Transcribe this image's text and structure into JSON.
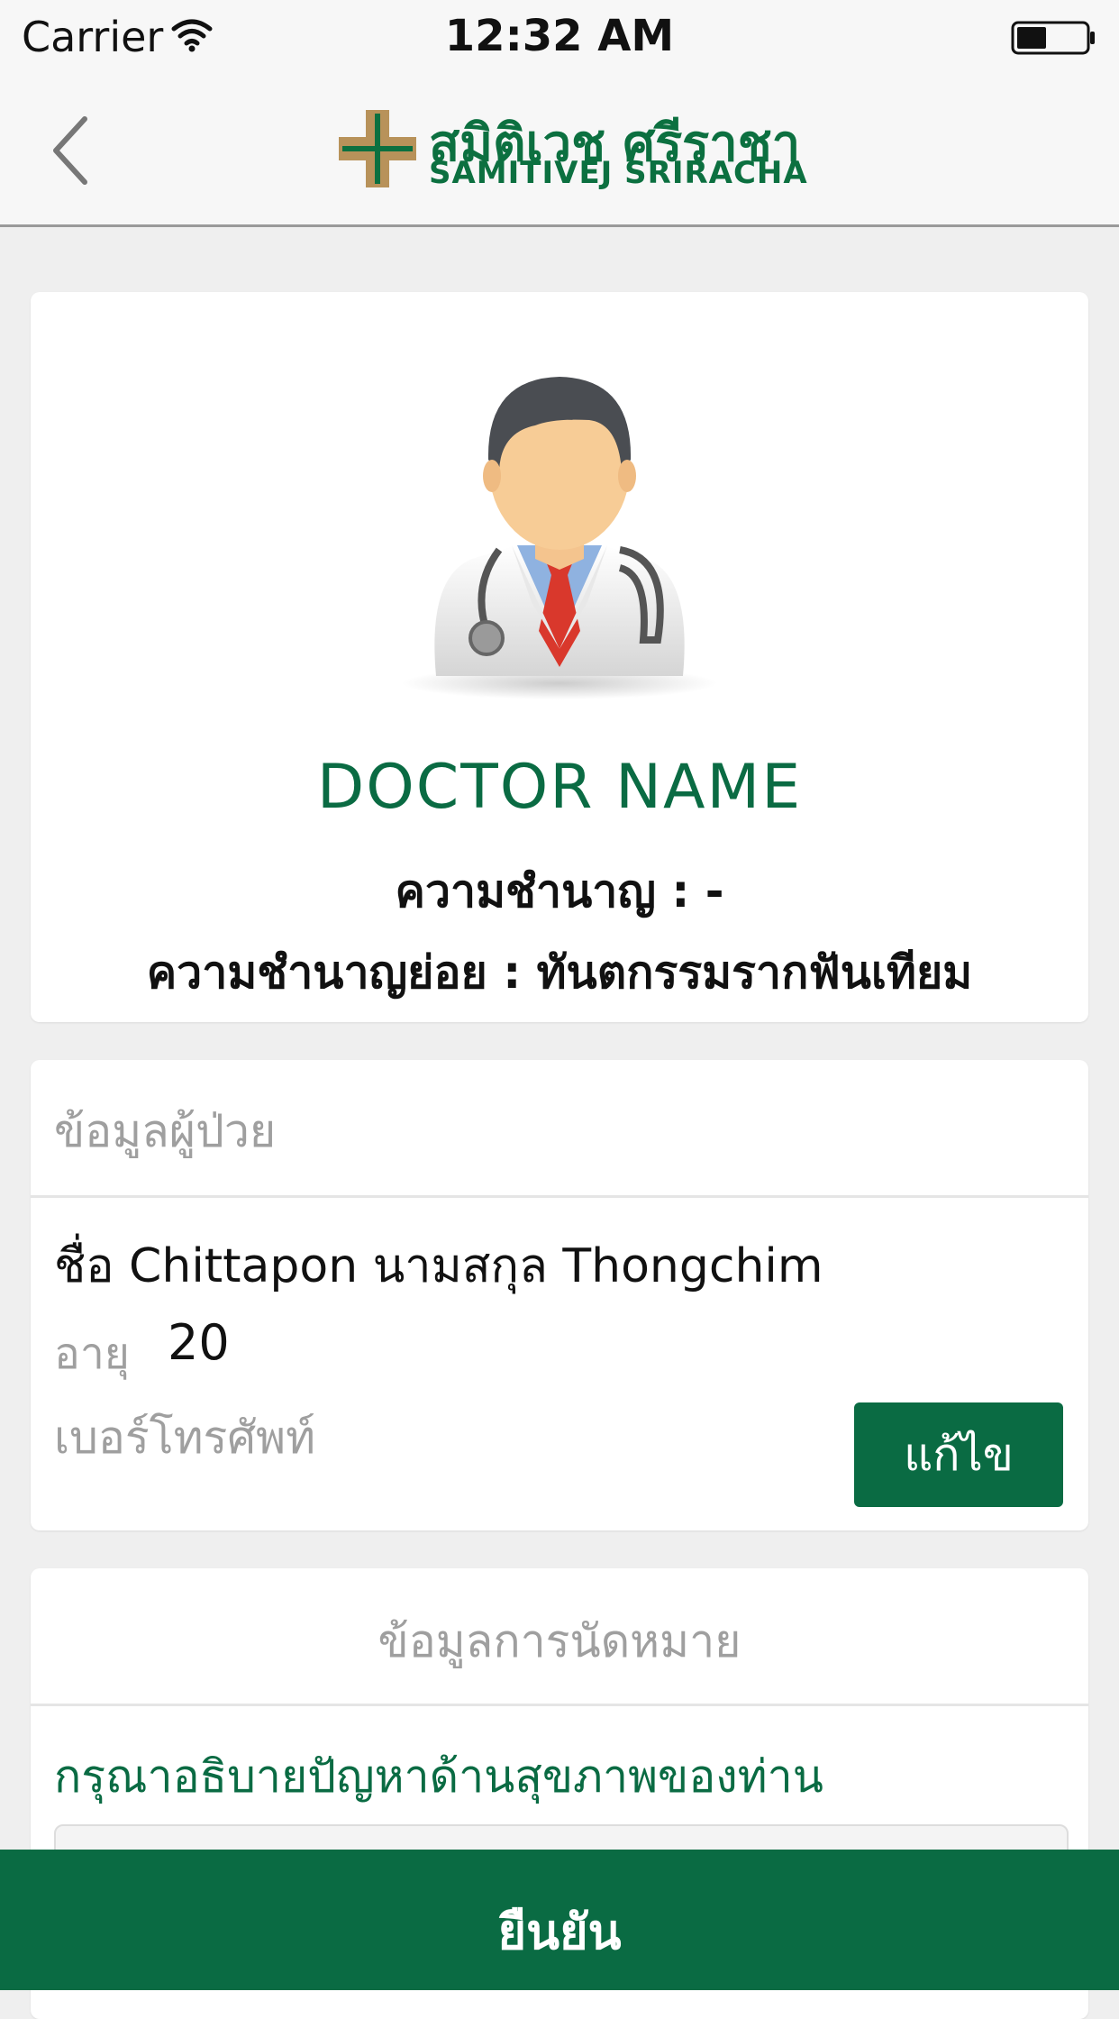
{
  "status_bar": {
    "carrier": "Carrier",
    "time": "12:32 AM"
  },
  "nav": {
    "logo_thai": "สมิติเวช ศรีราชา",
    "logo_english": "SAMITIVEJ SRIRACHA"
  },
  "doctor": {
    "name": "DOCTOR NAME",
    "specialty": "ความชำนาญ : -",
    "subspecialty": "ความชำนาญย่อย : ทันตกรรมรากฟันเทียม"
  },
  "patient": {
    "header": "ข้อมูลผู้ป่วย",
    "name_line": "ชื่อ Chittapon นามสกุล Thongchim",
    "age_label": "อายุ",
    "age_value": "20",
    "phone_label": "เบอร์โทรศัพท์",
    "edit_label": "แก้ไข"
  },
  "appointment": {
    "header": "ข้อมูลการนัดหมาย",
    "health_prompt": "กรุณาอธิบายปัญหาด้านสุขภาพของท่าน"
  },
  "footer": {
    "confirm_label": "ยืนยัน"
  },
  "colors": {
    "brand_green": "#0a6b43",
    "logo_gold": "#b8925a"
  }
}
